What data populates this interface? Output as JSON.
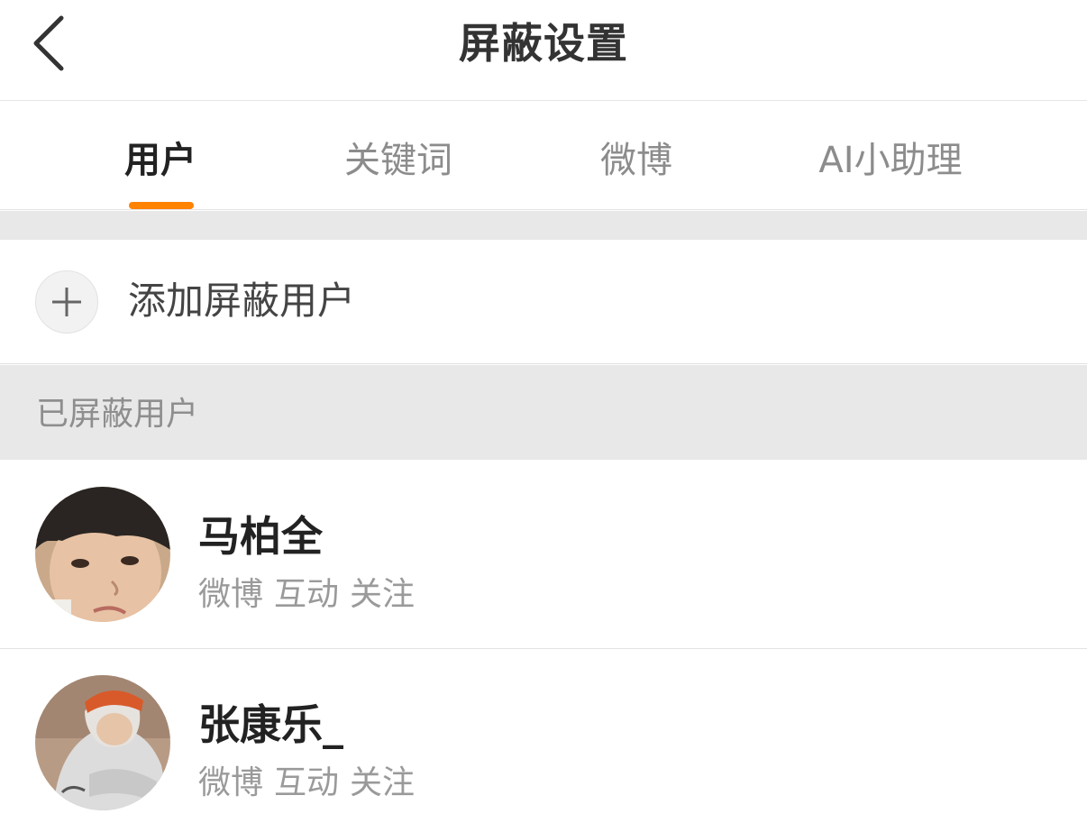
{
  "header": {
    "title": "屏蔽设置",
    "back_icon": "chevron-left-icon"
  },
  "tabs": [
    {
      "label": "用户",
      "active": true
    },
    {
      "label": "关键词",
      "active": false
    },
    {
      "label": "微博",
      "active": false
    },
    {
      "label": "AI小助理",
      "active": false
    }
  ],
  "accent_color": "#ff8200",
  "add_user": {
    "icon": "plus-icon",
    "label": "添加屏蔽用户"
  },
  "blocked_section": {
    "label": "已屏蔽用户"
  },
  "blocked_users": [
    {
      "name": "马柏全",
      "tags": [
        "微博",
        "互动",
        "关注"
      ],
      "avatar": "avatar-photo"
    },
    {
      "name": "张康乐_",
      "tags": [
        "微博",
        "互动",
        "关注"
      ],
      "avatar": "avatar-photo"
    }
  ]
}
